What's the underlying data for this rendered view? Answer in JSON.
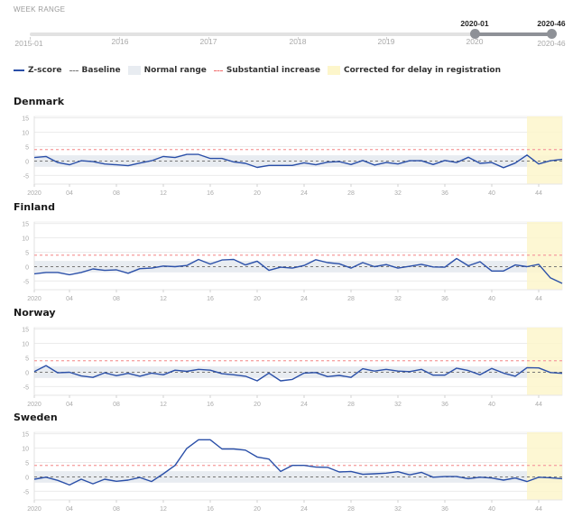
{
  "week_range": {
    "label": "WEEK RANGE",
    "ticks": [
      "2015-01",
      "2016",
      "2017",
      "2018",
      "2019",
      "2020",
      "2020-46"
    ],
    "selected_start": "2020-01",
    "selected_end": "2020-46"
  },
  "legend": {
    "zscore": "Z-score",
    "baseline": "Baseline",
    "normal_range": "Normal range",
    "substantial_increase": "Substantial increase",
    "corrected_delay": "Corrected for delay in registration"
  },
  "colors": {
    "zscore": "#2a4fa8",
    "baseline": "#777777",
    "normal_range": "#e8ecf1",
    "substantial_increase": "#f6a5a5",
    "corrected_delay": "#fdf6cb"
  },
  "chart_data": [
    {
      "type": "line",
      "title": "Denmark",
      "xlabel": "",
      "ylabel": "Z-score",
      "x": [
        1,
        2,
        3,
        4,
        5,
        6,
        7,
        8,
        9,
        10,
        11,
        12,
        13,
        14,
        15,
        16,
        17,
        18,
        19,
        20,
        21,
        22,
        23,
        24,
        25,
        26,
        27,
        28,
        29,
        30,
        31,
        32,
        33,
        34,
        35,
        36,
        37,
        38,
        39,
        40,
        41,
        42,
        43,
        44,
        45,
        46
      ],
      "xticks": [
        1,
        4,
        8,
        12,
        16,
        20,
        24,
        28,
        32,
        36,
        40,
        44
      ],
      "xtick_labels": [
        "2020",
        "04",
        "08",
        "12",
        "16",
        "20",
        "24",
        "28",
        "32",
        "36",
        "40",
        "44"
      ],
      "yticks": [
        -5,
        0,
        5,
        10,
        15
      ],
      "ylim": [
        -8,
        15.5
      ],
      "normal_range": [
        -2,
        2
      ],
      "baseline": 0,
      "substantial_increase": 4,
      "delay_start_week": 43,
      "series": [
        {
          "name": "Z-score",
          "values": [
            1.2,
            1.6,
            -0.5,
            -1.3,
            0.1,
            -0.2,
            -1.0,
            -1.3,
            -1.6,
            -0.7,
            0.1,
            1.6,
            1.2,
            2.3,
            2.3,
            0.9,
            0.9,
            -0.3,
            -0.8,
            -2.2,
            -1.5,
            -1.5,
            -1.5,
            -0.6,
            -1.3,
            -0.4,
            -0.2,
            -1.2,
            0.2,
            -1.4,
            -0.5,
            -1.0,
            0.1,
            0.1,
            -1.2,
            0.2,
            -0.5,
            1.3,
            -0.8,
            -0.5,
            -2.3,
            -0.7,
            2.1,
            -1.0,
            0.1,
            0.6
          ]
        }
      ],
      "grid": true
    },
    {
      "type": "line",
      "title": "Finland",
      "xlabel": "",
      "ylabel": "Z-score",
      "x": [
        1,
        2,
        3,
        4,
        5,
        6,
        7,
        8,
        9,
        10,
        11,
        12,
        13,
        14,
        15,
        16,
        17,
        18,
        19,
        20,
        21,
        22,
        23,
        24,
        25,
        26,
        27,
        28,
        29,
        30,
        31,
        32,
        33,
        34,
        35,
        36,
        37,
        38,
        39,
        40,
        41,
        42,
        43,
        44,
        45,
        46
      ],
      "xticks": [
        1,
        4,
        8,
        12,
        16,
        20,
        24,
        28,
        32,
        36,
        40,
        44
      ],
      "xtick_labels": [
        "2020",
        "04",
        "08",
        "12",
        "16",
        "20",
        "24",
        "28",
        "32",
        "36",
        "40",
        "44"
      ],
      "yticks": [
        -5,
        0,
        5,
        10,
        15
      ],
      "ylim": [
        -8,
        15.5
      ],
      "normal_range": [
        -2,
        2
      ],
      "baseline": 0,
      "substantial_increase": 4,
      "delay_start_week": 43,
      "series": [
        {
          "name": "Z-score",
          "values": [
            -2.5,
            -2.0,
            -2.0,
            -2.8,
            -2.0,
            -0.8,
            -1.3,
            -1.1,
            -2.3,
            -0.7,
            -0.5,
            0.2,
            0.0,
            0.4,
            2.5,
            0.9,
            2.3,
            2.5,
            0.6,
            1.9,
            -1.3,
            -0.2,
            -0.5,
            0.4,
            2.4,
            1.4,
            1.0,
            -0.5,
            1.4,
            0.0,
            0.7,
            -0.5,
            0.1,
            0.8,
            -0.1,
            -0.2,
            2.8,
            0.3,
            1.7,
            -1.5,
            -1.5,
            0.6,
            0.0,
            0.8,
            -3.9,
            -5.8
          ]
        }
      ],
      "grid": true
    },
    {
      "type": "line",
      "title": "Norway",
      "xlabel": "",
      "ylabel": "Z-score",
      "x": [
        1,
        2,
        3,
        4,
        5,
        6,
        7,
        8,
        9,
        10,
        11,
        12,
        13,
        14,
        15,
        16,
        17,
        18,
        19,
        20,
        21,
        22,
        23,
        24,
        25,
        26,
        27,
        28,
        29,
        30,
        31,
        32,
        33,
        34,
        35,
        36,
        37,
        38,
        39,
        40,
        41,
        42,
        43,
        44,
        45,
        46
      ],
      "xticks": [
        1,
        4,
        8,
        12,
        16,
        20,
        24,
        28,
        32,
        36,
        40,
        44
      ],
      "xtick_labels": [
        "2020",
        "04",
        "08",
        "12",
        "16",
        "20",
        "24",
        "28",
        "32",
        "36",
        "40",
        "44"
      ],
      "yticks": [
        -5,
        0,
        5,
        10,
        15
      ],
      "ylim": [
        -8,
        15.5
      ],
      "normal_range": [
        -2,
        2
      ],
      "baseline": 0,
      "substantial_increase": 4,
      "delay_start_week": 43,
      "series": [
        {
          "name": "Z-score",
          "values": [
            0.2,
            2.3,
            -0.2,
            0.0,
            -1.3,
            -1.8,
            -0.2,
            -1.2,
            -0.4,
            -1.4,
            -0.3,
            -0.9,
            0.7,
            0.3,
            1.0,
            0.7,
            -0.5,
            -0.9,
            -1.4,
            -3.0,
            -0.3,
            -3.0,
            -2.5,
            -0.3,
            -0.1,
            -1.5,
            -1.1,
            -1.8,
            1.2,
            0.4,
            1.0,
            0.4,
            0.2,
            1.0,
            -1.0,
            -1.0,
            1.4,
            0.6,
            -0.9,
            1.3,
            -0.3,
            -1.4,
            1.6,
            1.5,
            -0.1,
            -0.4
          ]
        }
      ],
      "grid": true
    },
    {
      "type": "line",
      "title": "Sweden",
      "xlabel": "",
      "ylabel": "Z-score",
      "x": [
        1,
        2,
        3,
        4,
        5,
        6,
        7,
        8,
        9,
        10,
        11,
        12,
        13,
        14,
        15,
        16,
        17,
        18,
        19,
        20,
        21,
        22,
        23,
        24,
        25,
        26,
        27,
        28,
        29,
        30,
        31,
        32,
        33,
        34,
        35,
        36,
        37,
        38,
        39,
        40,
        41,
        42,
        43,
        44,
        45,
        46
      ],
      "xticks": [
        1,
        4,
        8,
        12,
        16,
        20,
        24,
        28,
        32,
        36,
        40,
        44
      ],
      "xtick_labels": [
        "2020",
        "04",
        "08",
        "12",
        "16",
        "20",
        "24",
        "28",
        "32",
        "36",
        "40",
        "44"
      ],
      "yticks": [
        -5,
        0,
        5,
        10,
        15
      ],
      "ylim": [
        -8,
        15.5
      ],
      "normal_range": [
        -2,
        2
      ],
      "baseline": 0,
      "substantial_increase": 4,
      "delay_start_week": 43,
      "series": [
        {
          "name": "Z-score",
          "values": [
            -0.8,
            -0.1,
            -1.2,
            -2.8,
            -0.8,
            -2.4,
            -0.8,
            -1.5,
            -1.1,
            -0.2,
            -1.6,
            1.1,
            4.0,
            9.9,
            12.9,
            12.9,
            9.7,
            9.7,
            9.3,
            6.9,
            6.2,
            1.9,
            4.0,
            4.0,
            3.4,
            3.3,
            1.7,
            1.9,
            0.9,
            1.1,
            1.3,
            1.8,
            0.7,
            1.6,
            -0.1,
            0.1,
            0.1,
            -0.6,
            -0.1,
            -0.4,
            -1.1,
            -0.4,
            -1.6,
            -0.1,
            -0.3,
            -0.6
          ]
        }
      ],
      "grid": true
    }
  ]
}
